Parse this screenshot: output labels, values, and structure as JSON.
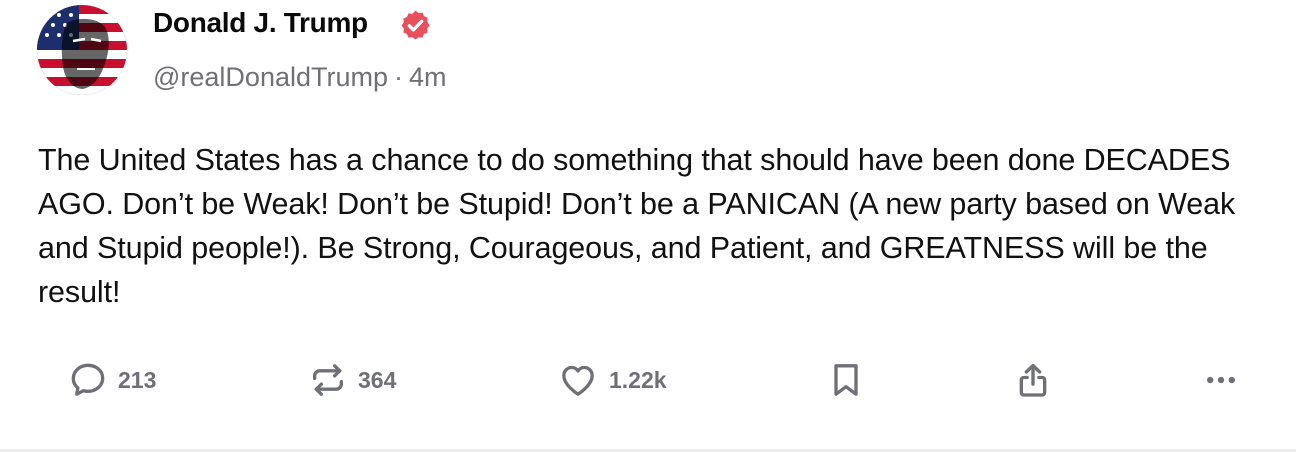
{
  "post": {
    "author": {
      "display_name": "Donald J. Trump",
      "handle": "@realDonaldTrump",
      "verified": true,
      "verified_badge_color": "#e8505b"
    },
    "separator": "·",
    "time_ago": "4m",
    "text": "The United States has a chance to do something that should have been done DECADES AGO. Don’t be Weak! Don’t be Stupid! Don’t be a PANICAN (A new party based on Weak and Stupid people!). Be Strong, Courageous, and Patient, and GREATNESS will be the result!",
    "actions": {
      "reply": {
        "icon": "speech-bubble-icon",
        "count": "213"
      },
      "repost": {
        "icon": "repost-arrows-icon",
        "count": "364"
      },
      "like": {
        "icon": "heart-icon",
        "count": "1.22k"
      },
      "bookmark": {
        "icon": "bookmark-icon"
      },
      "share": {
        "icon": "share-icon"
      },
      "more": {
        "icon": "ellipsis-icon"
      }
    },
    "icon_color": "#6f6f78"
  }
}
